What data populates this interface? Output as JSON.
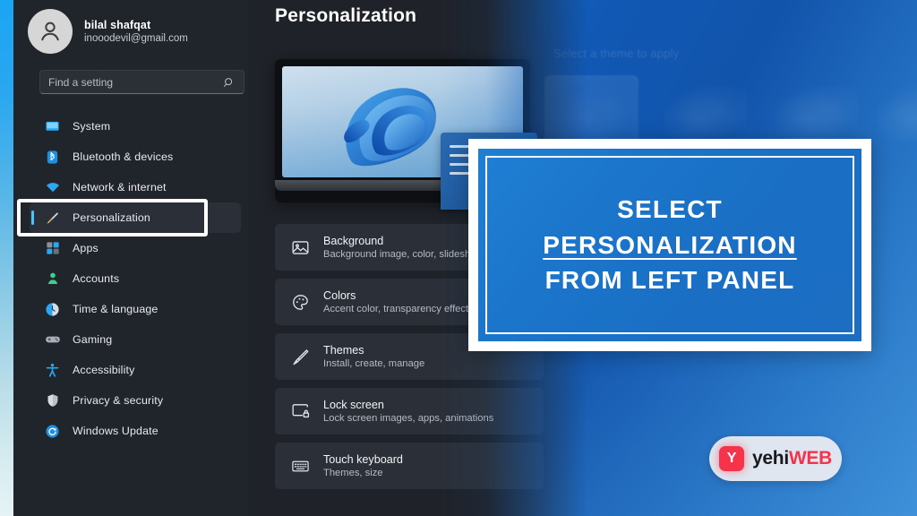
{
  "account": {
    "name": "bilal shafqat",
    "email": "inooodevil@gmail.com",
    "avatar_icon": "person-icon"
  },
  "search": {
    "placeholder": "Find a setting",
    "value": "Find a setting",
    "icon": "search-icon"
  },
  "sidebar": {
    "items": [
      {
        "label": "System",
        "icon": "monitor-icon",
        "selected": false
      },
      {
        "label": "Bluetooth & devices",
        "icon": "bluetooth-icon",
        "selected": false
      },
      {
        "label": "Network & internet",
        "icon": "wifi-icon",
        "selected": false
      },
      {
        "label": "Personalization",
        "icon": "paintbrush-icon",
        "selected": true
      },
      {
        "label": "Apps",
        "icon": "apps-grid-icon",
        "selected": false
      },
      {
        "label": "Accounts",
        "icon": "person-badge-icon",
        "selected": false
      },
      {
        "label": "Time & language",
        "icon": "clock-icon",
        "selected": false
      },
      {
        "label": "Gaming",
        "icon": "gamepad-icon",
        "selected": false
      },
      {
        "label": "Accessibility",
        "icon": "accessibility-person-icon",
        "selected": false
      },
      {
        "label": "Privacy & security",
        "icon": "shield-icon",
        "selected": false
      },
      {
        "label": "Windows Update",
        "icon": "refresh-circle-icon",
        "selected": false
      }
    ]
  },
  "main": {
    "title": "Personalization",
    "themes_label": "Select a theme to apply",
    "theme_preview_name": "windows-11-bloom-theme",
    "settings": [
      {
        "title": "Background",
        "sub": "Background image, color, slideshow",
        "icon": "picture-icon"
      },
      {
        "title": "Colors",
        "sub": "Accent color, transparency effects, color",
        "icon": "palette-icon"
      },
      {
        "title": "Themes",
        "sub": "Install, create, manage",
        "icon": "paintbrush-icon"
      },
      {
        "title": "Lock screen",
        "sub": "Lock screen images, apps, animations",
        "icon": "lock-screen-icon"
      },
      {
        "title": "Touch keyboard",
        "sub": "Themes, size",
        "icon": "keyboard-icon"
      }
    ]
  },
  "callout": {
    "line1": "SELECT",
    "line2": "PERSONALIZATION",
    "line3": "FROM LEFT PANEL",
    "border_color": "#ffffff",
    "fill_color": "#1b73c8"
  },
  "badge": {
    "mark": "Y",
    "word_dark": "yehi",
    "word_accent": "WEB",
    "mark_color": "#f5334b",
    "accent_color": "#f5334b"
  },
  "colors": {
    "sidebar_bg": "#20242b",
    "window_bg": "#1f2228",
    "card_bg": "#2b3038",
    "accent_blue": "#4cc2ff",
    "backdrop_blue": "#1158b4"
  }
}
